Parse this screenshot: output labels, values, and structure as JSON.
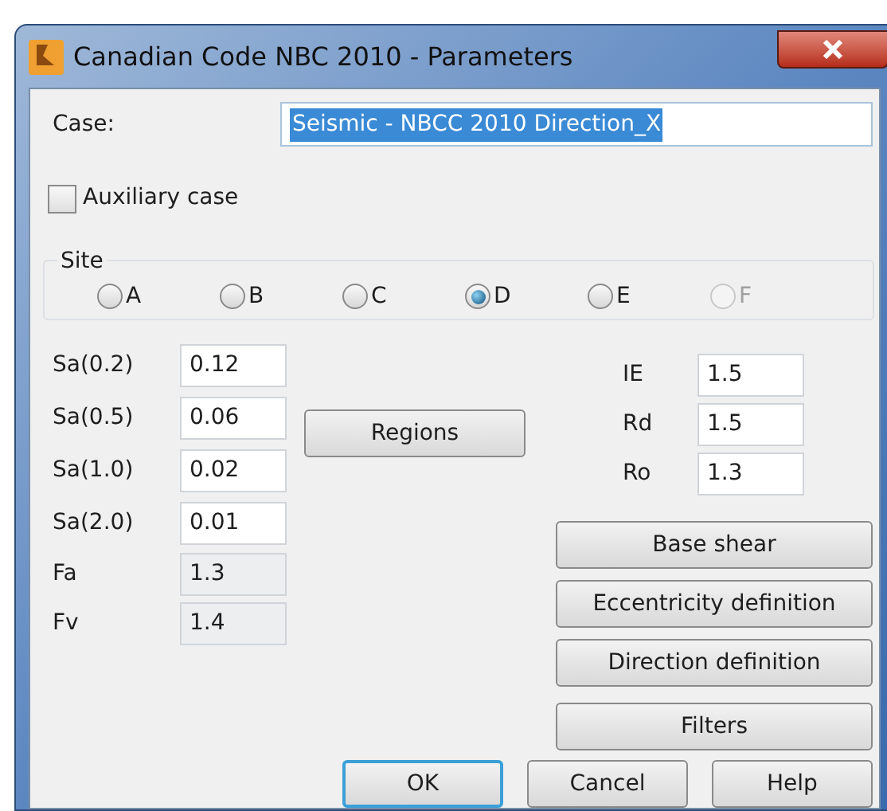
{
  "window": {
    "title": "Canadian Code NBC 2010 - Parameters"
  },
  "case": {
    "label": "Case:",
    "value": "Seismic - NBCC 2010 Direction_X"
  },
  "auxiliary": {
    "label": "Auxiliary case",
    "checked": false
  },
  "site": {
    "title": "Site",
    "options": [
      {
        "label": "A",
        "selected": false,
        "disabled": false
      },
      {
        "label": "B",
        "selected": false,
        "disabled": false
      },
      {
        "label": "C",
        "selected": false,
        "disabled": false
      },
      {
        "label": "D",
        "selected": true,
        "disabled": false
      },
      {
        "label": "E",
        "selected": false,
        "disabled": false
      },
      {
        "label": "F",
        "selected": false,
        "disabled": true
      }
    ]
  },
  "left_fields": [
    {
      "label": "Sa(0.2)",
      "value": "0.12",
      "disabled": false
    },
    {
      "label": "Sa(0.5)",
      "value": "0.06",
      "disabled": false
    },
    {
      "label": "Sa(1.0)",
      "value": "0.02",
      "disabled": false
    },
    {
      "label": "Sa(2.0)",
      "value": "0.01",
      "disabled": false
    },
    {
      "label": "Fa",
      "value": "1.3",
      "disabled": true
    },
    {
      "label": "Fv",
      "value": "1.4",
      "disabled": true
    }
  ],
  "regions_button": "Regions",
  "right_fields": [
    {
      "label": "IE",
      "value": "1.5"
    },
    {
      "label": "Rd",
      "value": "1.5"
    },
    {
      "label": "Ro",
      "value": "1.3"
    }
  ],
  "side_buttons": [
    "Base shear",
    "Eccentricity definition",
    "Direction definition",
    "Filters"
  ],
  "buttons": [
    {
      "label": "OK",
      "default": true
    },
    {
      "label": "Cancel",
      "default": false
    },
    {
      "label": "Help",
      "default": false
    }
  ]
}
